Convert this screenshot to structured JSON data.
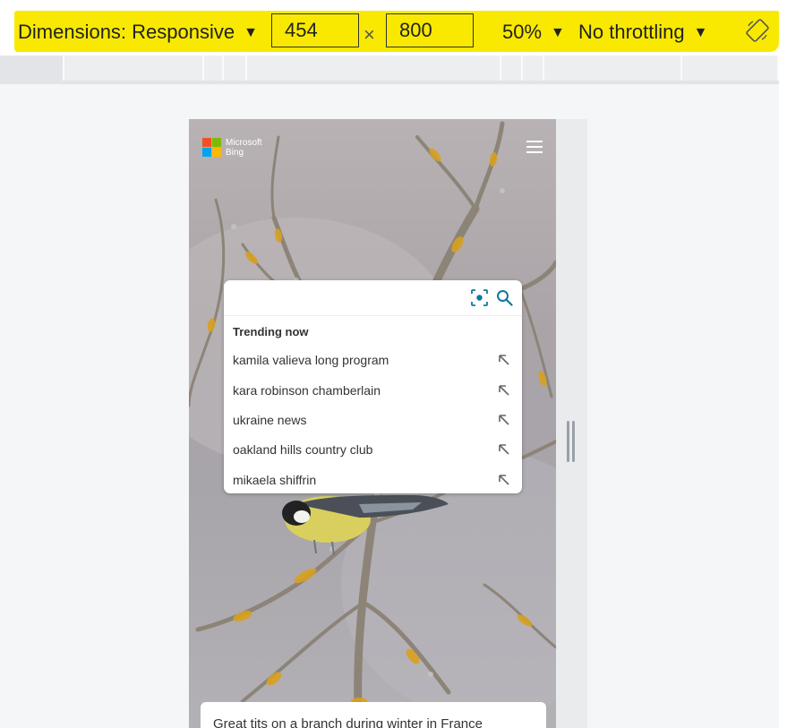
{
  "toolbar": {
    "dimensions_label": "Dimensions: Responsive",
    "width_value": "454",
    "times_symbol": "×",
    "height_value": "800",
    "zoom_label": "50%",
    "throttling_label": "No throttling",
    "caret": "▼",
    "rotate_icon": "rotate-icon",
    "highlight_color": "#f9e900"
  },
  "viewport": {
    "logo": {
      "line1": "Microsoft",
      "line2": "Bing"
    },
    "search": {
      "value": "",
      "trending_title": "Trending now",
      "suggestions": [
        "kamila valieva long program",
        "kara robinson chamberlain",
        "ukraine news",
        "oakland hills country club",
        "mikaela shiffrin"
      ]
    },
    "caption": "Great tits on a branch during winter in France",
    "colors": {
      "lichen": "#d9a11e",
      "bird_yellow": "#d8cf5e",
      "accent": "#0e7a9b"
    }
  }
}
